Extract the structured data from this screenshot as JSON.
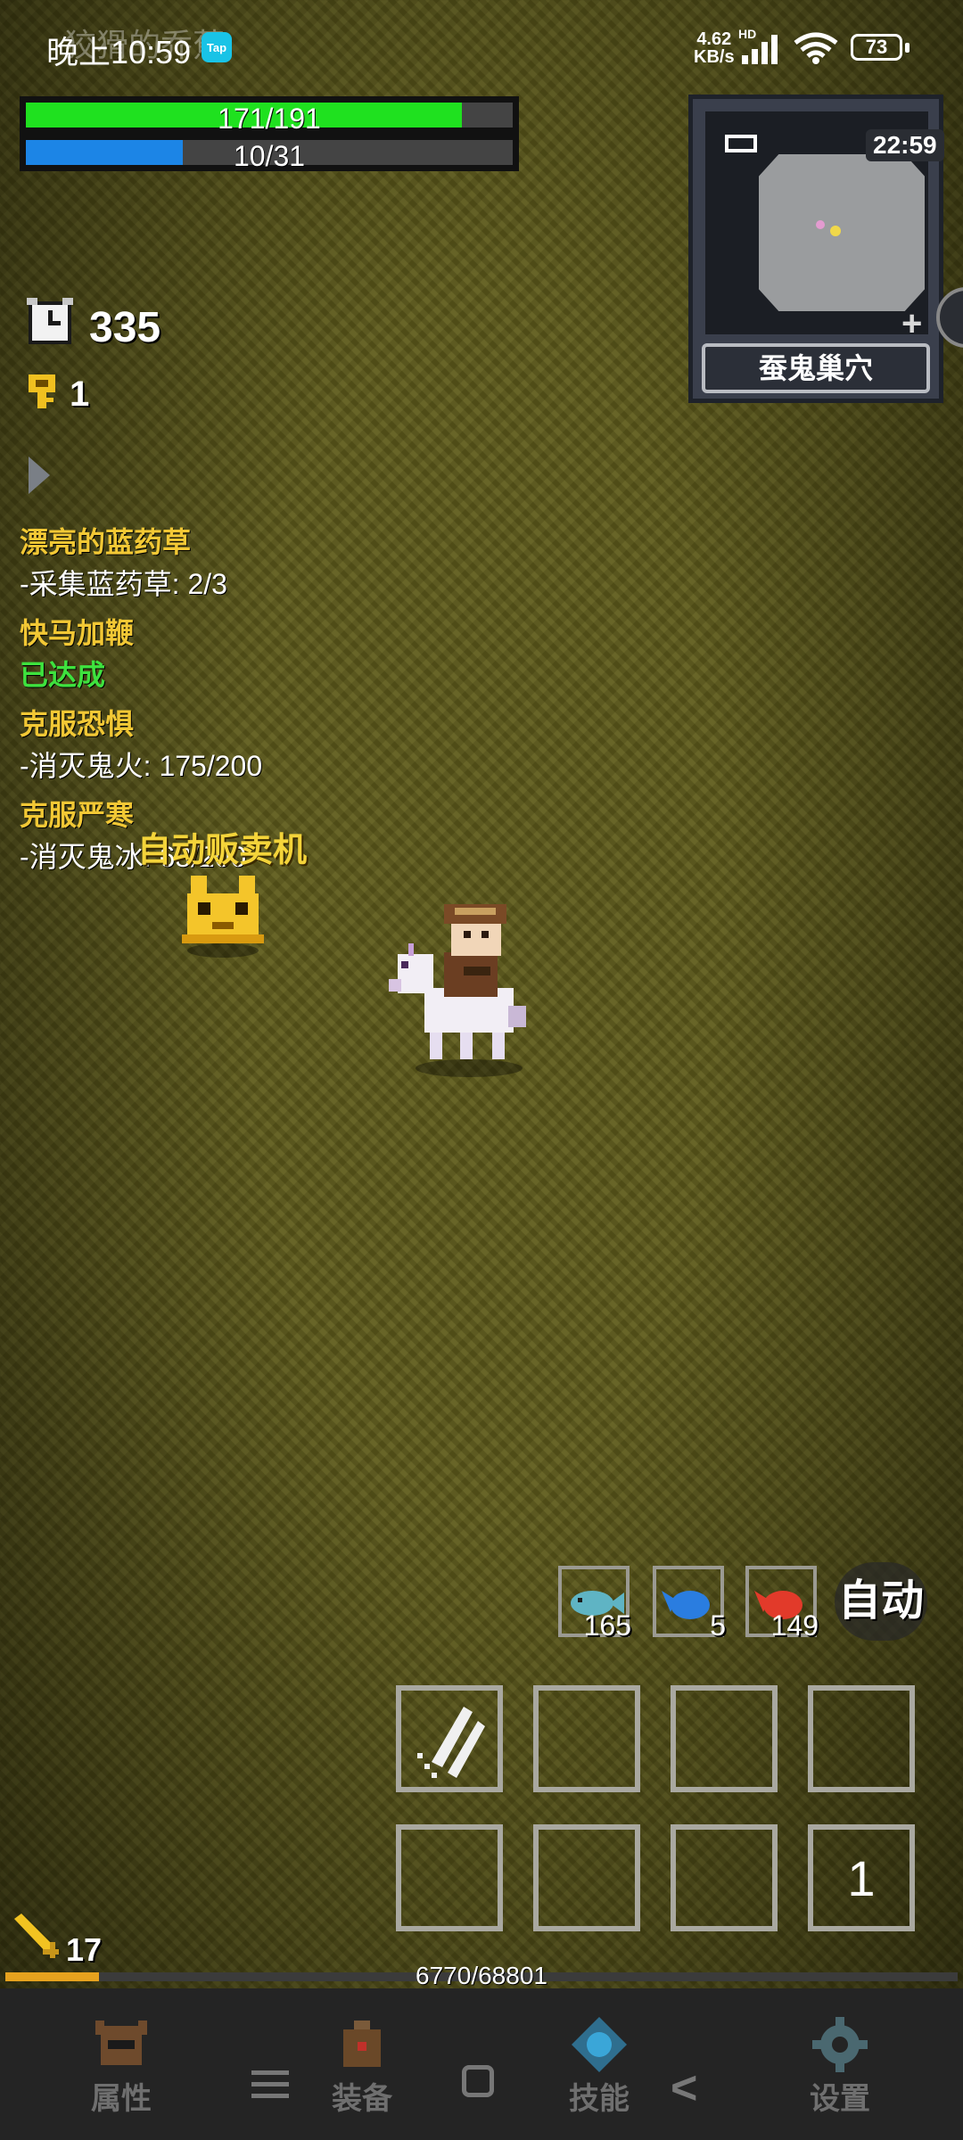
{
  "status_bar": {
    "time": "晚上10:59",
    "ghost_text": "狡猾的乔蕉",
    "app_badge": "Tap",
    "net_speed_value": "4.62",
    "net_speed_unit": "KB/s",
    "network_label": "HD",
    "battery": "73"
  },
  "hud": {
    "hp": {
      "text": "171/191",
      "current": 171,
      "max": 191,
      "color": "#1fe11f"
    },
    "mp": {
      "text": "10/31",
      "current": 10,
      "max": 31,
      "color": "#1c85e6"
    }
  },
  "minimap": {
    "clock": "22:59",
    "area_name": "蚕鬼巢穴"
  },
  "counters": {
    "turns": "335",
    "keys": "1"
  },
  "quests": [
    {
      "title": "漂亮的蓝药草",
      "detail": "-采集蓝药草: 2/3",
      "done": false
    },
    {
      "title": "快马加鞭",
      "detail": "已达成",
      "done": true
    },
    {
      "title": "克服恐惧",
      "detail": "-消灭鬼火: 175/200",
      "done": false
    },
    {
      "title": "克服严寒",
      "detail": "-消灭鬼冰: 68/200",
      "done": false
    }
  ],
  "vendor": {
    "label": "自动贩卖机"
  },
  "potions": [
    {
      "icon": "fish-icon",
      "count": "165",
      "color": "#5fb4c4"
    },
    {
      "icon": "blue-fish-icon",
      "count": "5",
      "color": "#2a7de0"
    },
    {
      "icon": "red-meat-icon",
      "count": "149",
      "color": "#e23a2a"
    }
  ],
  "auto_label": "自动",
  "skill_slot_count": "1",
  "level": "17",
  "xp": {
    "text": "6770/68801",
    "current": 6770,
    "max": 68801
  },
  "nav": [
    {
      "label": "属性",
      "icon": "helmet-icon"
    },
    {
      "label": "装备",
      "icon": "bag-icon"
    },
    {
      "label": "技能",
      "icon": "skill-orb-icon"
    },
    {
      "label": "设置",
      "icon": "gear-icon"
    }
  ]
}
